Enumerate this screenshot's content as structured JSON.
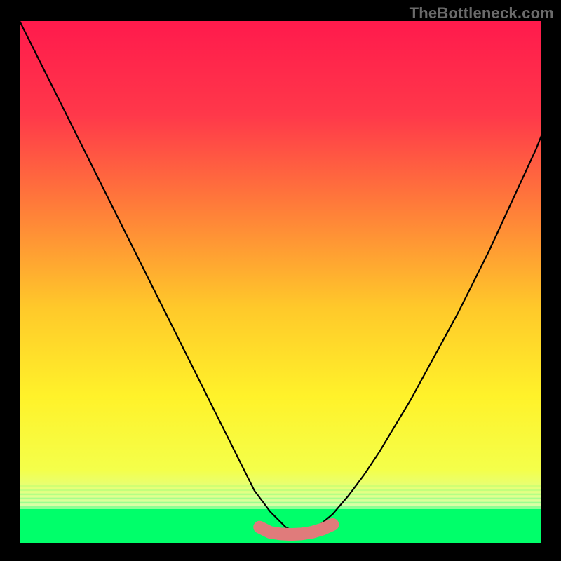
{
  "watermark": {
    "text": "TheBottleneck.com"
  },
  "chart_data": {
    "type": "line",
    "title": "",
    "xlabel": "",
    "ylabel": "",
    "xlim": [
      0,
      100
    ],
    "ylim": [
      0,
      100
    ],
    "series": [
      {
        "name": "curve",
        "color": "#000000",
        "x": [
          0,
          3,
          6,
          9,
          12,
          15,
          18,
          21,
          24,
          27,
          30,
          33,
          36,
          39,
          42,
          45,
          48,
          51,
          53,
          55,
          57,
          60,
          63,
          66,
          69,
          72,
          75,
          78,
          81,
          84,
          87,
          90,
          93,
          96,
          99,
          100
        ],
        "y": [
          100,
          94,
          88,
          82,
          76,
          70,
          64,
          58,
          52,
          46,
          40,
          34,
          28,
          22,
          16,
          10,
          6,
          3,
          2,
          2,
          3,
          5.5,
          9,
          13,
          17.5,
          22.5,
          27.5,
          33,
          38.5,
          44,
          50,
          56,
          62.5,
          69,
          75.5,
          78
        ]
      },
      {
        "name": "green-band",
        "color": "#00ff6a",
        "type": "band",
        "y_top": 6.5,
        "y_bottom": 0
      },
      {
        "name": "optimal-marker",
        "color": "#e07b7b",
        "type": "thick-segment",
        "x": [
          46,
          48,
          50,
          52,
          54,
          56,
          58,
          60
        ],
        "y": [
          3.0,
          2.0,
          1.7,
          1.6,
          1.7,
          2.0,
          2.6,
          3.5
        ]
      }
    ],
    "background": {
      "type": "vertical-gradient",
      "stops": [
        {
          "offset": 0.0,
          "color": "#ff1a4c"
        },
        {
          "offset": 0.18,
          "color": "#ff384a"
        },
        {
          "offset": 0.35,
          "color": "#ff7a3a"
        },
        {
          "offset": 0.55,
          "color": "#ffc92a"
        },
        {
          "offset": 0.72,
          "color": "#fff22a"
        },
        {
          "offset": 0.86,
          "color": "#f4ff4a"
        },
        {
          "offset": 0.935,
          "color": "#d6ffb0"
        },
        {
          "offset": 1.0,
          "color": "#00ff6a"
        }
      ]
    }
  }
}
